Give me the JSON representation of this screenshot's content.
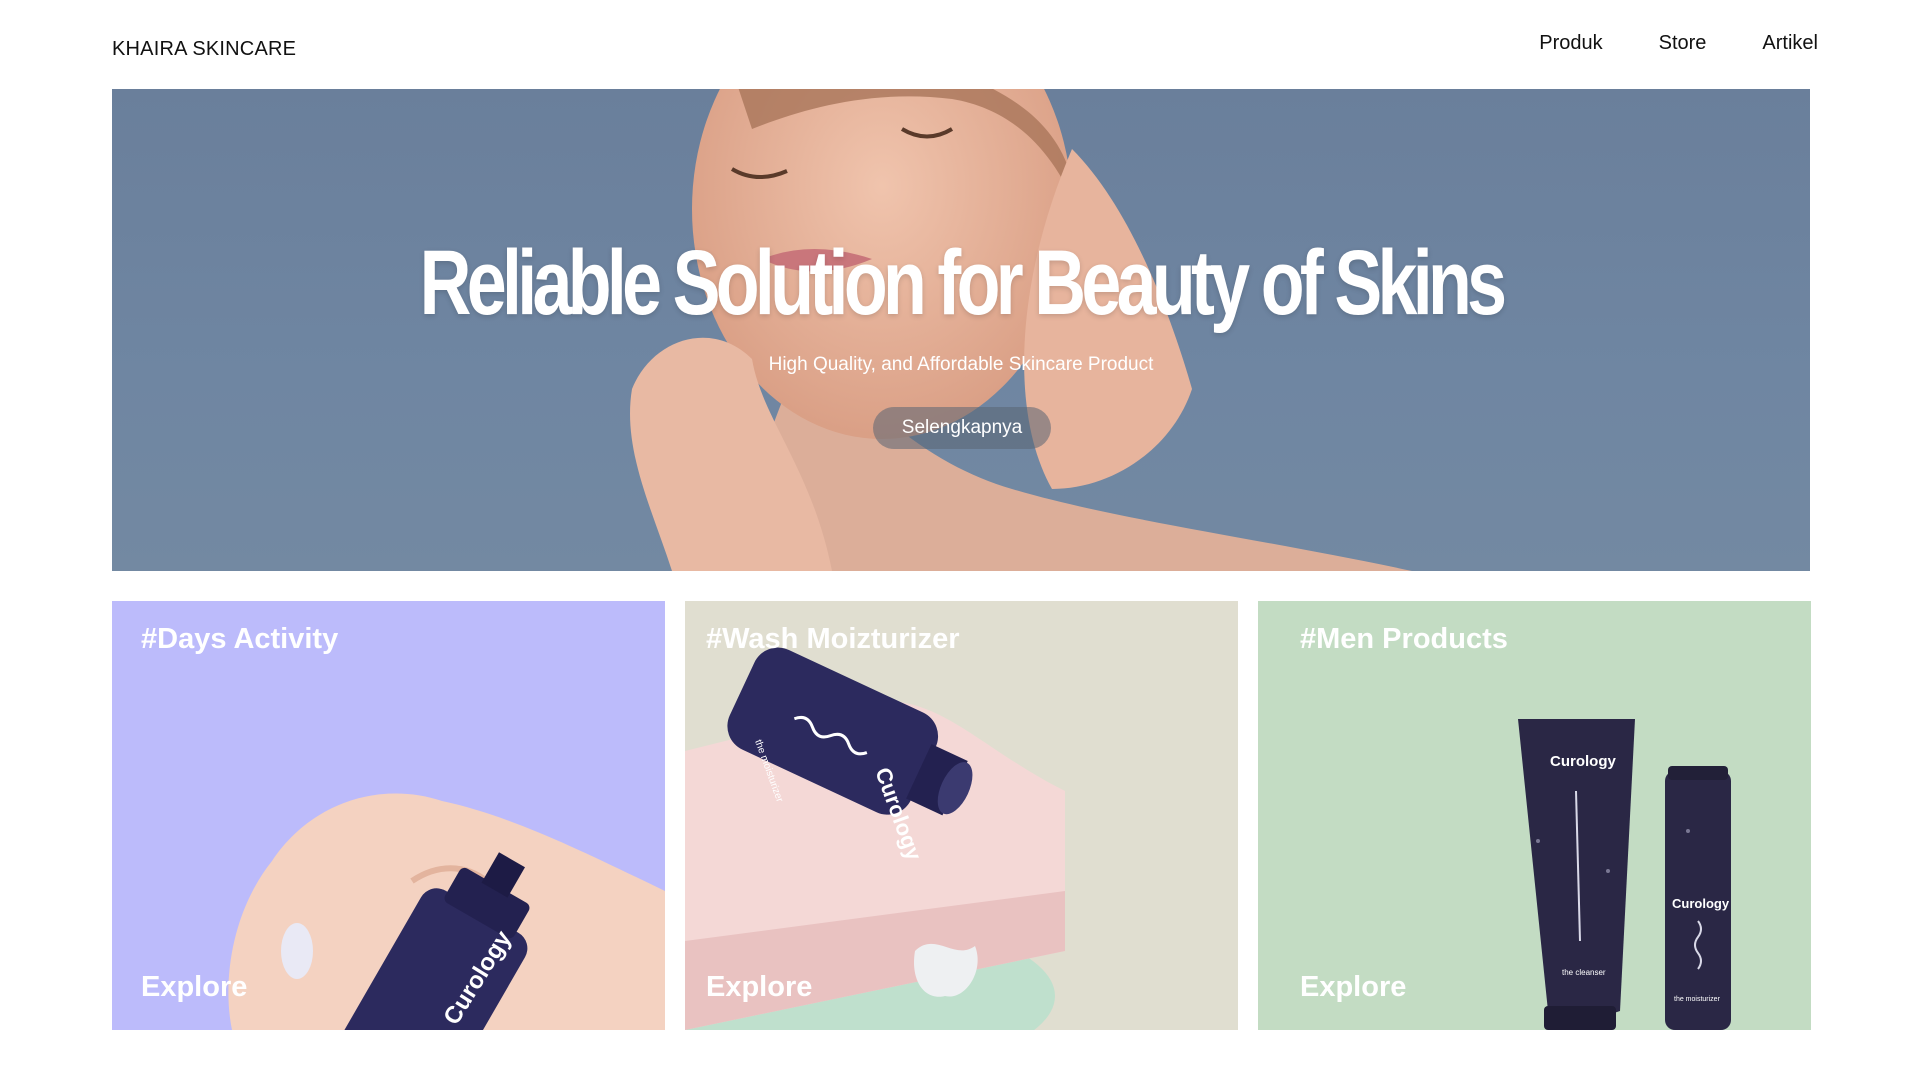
{
  "brand": "KHAIRA SKINCARE",
  "nav": {
    "items": [
      "Produk",
      "Store",
      "Artikel"
    ]
  },
  "hero": {
    "title": "Reliable Solution for Beauty of Skins",
    "subtitle": "High Quality, and Affordable Skincare Product",
    "button_label": "Selengkapnya"
  },
  "cards": [
    {
      "title": "#Days Activity",
      "explore": "Explore",
      "bottle_label": "Curology",
      "bg": "#bcbbfb"
    },
    {
      "title": "#Wash Moizturizer",
      "explore": "Explore",
      "bottle_label": "Curology",
      "bottle_caption": "the moisturizer",
      "bg": "#e0ded0"
    },
    {
      "title": "#Men Products",
      "explore": "Explore",
      "bottle_label": "Curology",
      "tube_caption": "the cleanser",
      "pump_caption": "the moisturizer",
      "bg": "#c3dcc3"
    }
  ],
  "colors": {
    "product_navy": "#2c2a5e",
    "hero_bg": "#6f86a2"
  }
}
